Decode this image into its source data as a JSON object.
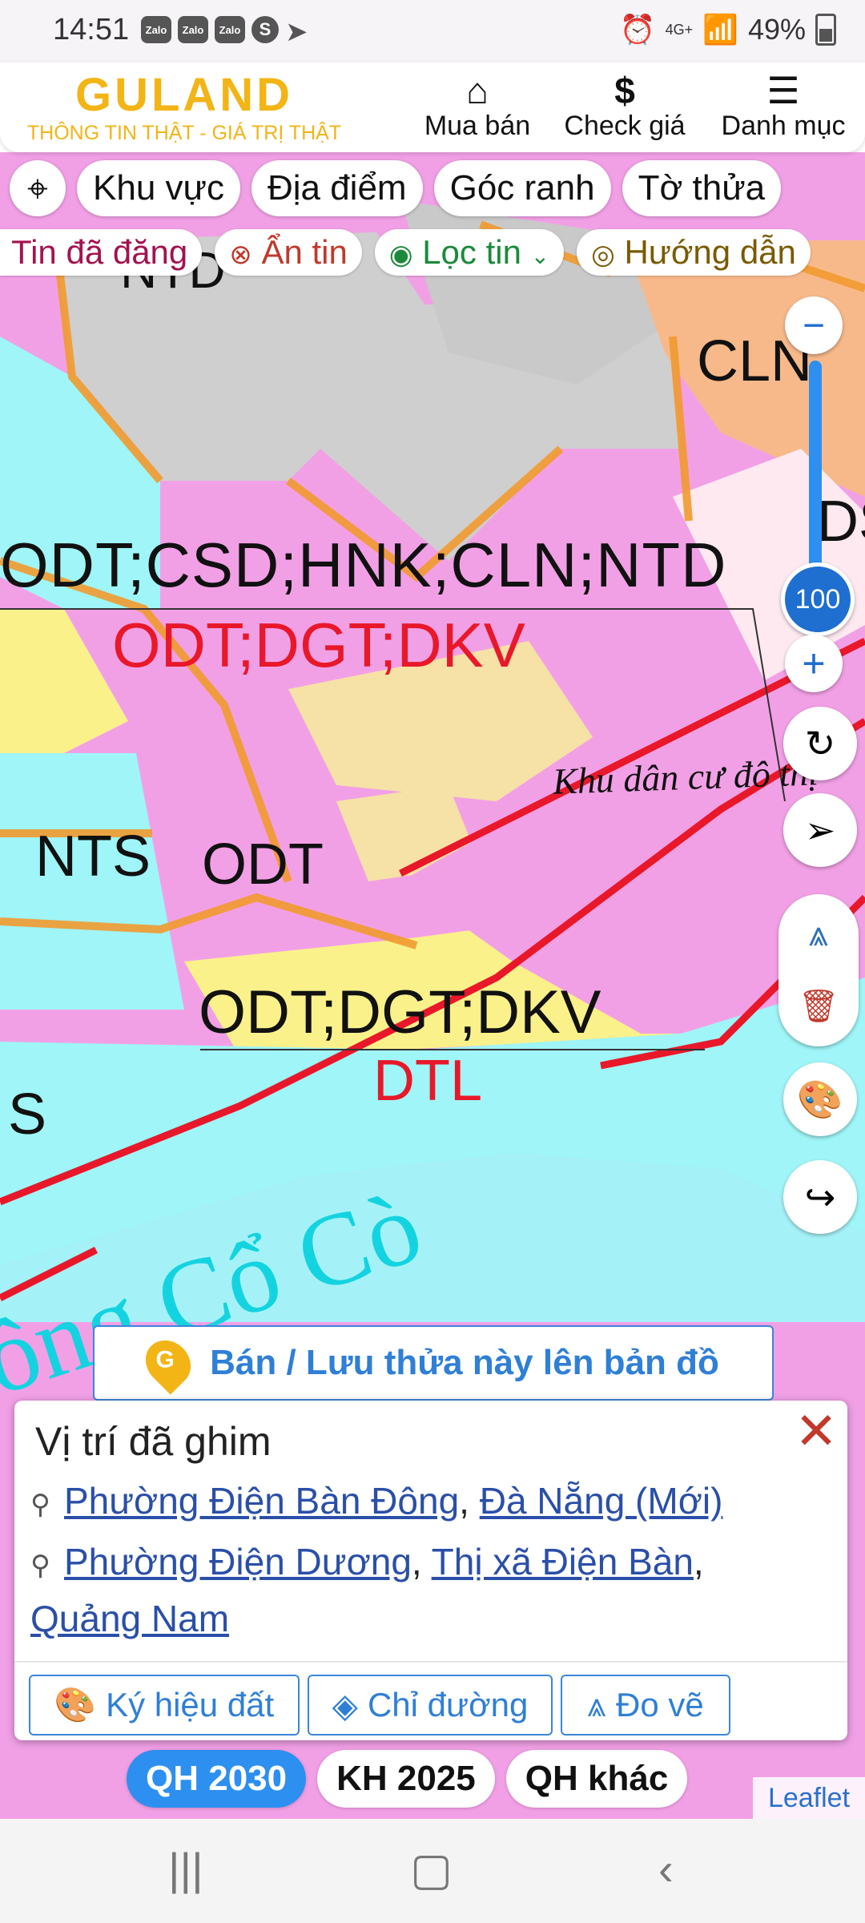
{
  "status_bar": {
    "time": "14:51",
    "apps": [
      "Zalo",
      "Zalo",
      "Zalo"
    ],
    "s_app": "S",
    "network": "4G+",
    "battery": "49%"
  },
  "header": {
    "logo_text": "GULAND",
    "tagline": "THÔNG TIN THẬT - GIÁ TRỊ THẬT",
    "nav": [
      {
        "label": "Mua bán",
        "icon": "house-icon"
      },
      {
        "label": "Check giá",
        "icon": "dollar-icon"
      },
      {
        "label": "Danh mục",
        "icon": "menu-icon"
      }
    ]
  },
  "filter_chips": [
    "Khu vực",
    "Địa điểm",
    "Góc ranh",
    "Tờ thửa"
  ],
  "secondary_chips": [
    "Tin đã đăng",
    "Ẩn tin",
    "Lọc tin",
    "Hướng dẫn"
  ],
  "map_labels": {
    "ntd": "NTD",
    "cln": "CLN",
    "ds": "DS",
    "line1": "ODT;CSD;HNK;CLN;NTD",
    "line2": "ODT;DGT;DKV",
    "residential": "Khu dân cư đô thị",
    "nts": "NTS",
    "odt": "ODT",
    "line3": "ODT;DGT;DKV",
    "dtl": "DTL",
    "s": "S",
    "river": "Sông Cổ Cò"
  },
  "zoom": {
    "level": "100"
  },
  "sell_button": "Bán / Lưu thửa này lên bản đồ",
  "popup": {
    "title": "Vị trí đã ghim",
    "loc1": {
      "ward": "Phường Điện Bàn Đông",
      "city": "Đà Nẵng (Mới)"
    },
    "loc2": {
      "ward": "Phường Điện Dương",
      "town": "Thị xã Điện Bàn",
      "province": "Quảng Nam"
    },
    "buttons": [
      "Ký hiệu đất",
      "Chỉ đường",
      "Đo vẽ"
    ]
  },
  "plan_tabs": [
    "QH 2030",
    "KH 2025",
    "QH khác"
  ],
  "attribution": "Leaflet",
  "colors": {
    "brand": "#f3b416",
    "accent": "#2d8ff0",
    "residential_land": "#f2a0e6",
    "water": "#9ff5f7",
    "boundary": "#e8182a"
  }
}
